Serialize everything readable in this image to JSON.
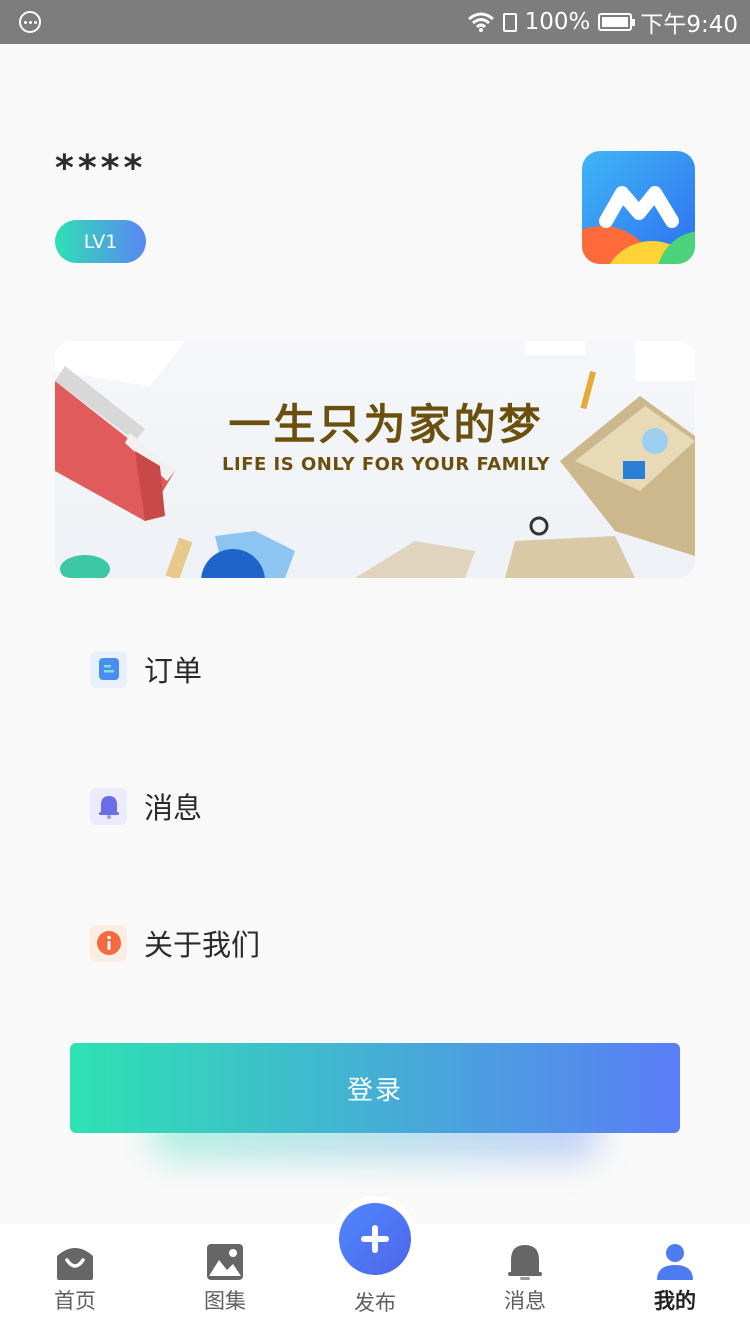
{
  "status_bar": {
    "battery": "100%",
    "time": "下午9:40"
  },
  "profile": {
    "name": "****",
    "level": "LV1"
  },
  "banner": {
    "title": "一生只为家的梦",
    "subtitle": "LIFE IS ONLY FOR YOUR FAMILY"
  },
  "menu": [
    {
      "label": "订单",
      "icon": "order-icon"
    },
    {
      "label": "消息",
      "icon": "bell-icon"
    },
    {
      "label": "关于我们",
      "icon": "info-icon"
    }
  ],
  "login_label": "登录",
  "tabs": [
    {
      "label": "首页",
      "icon": "home-bag-icon"
    },
    {
      "label": "图集",
      "icon": "image-gallery-icon"
    },
    {
      "label": "发布",
      "icon": "plus-icon"
    },
    {
      "label": "消息",
      "icon": "bell-icon"
    },
    {
      "label": "我的",
      "icon": "person-icon",
      "active": true
    }
  ],
  "colors": {
    "accent_start": "#2fe0b4",
    "accent_end": "#5a7df6",
    "banner_text": "#6b4f0c"
  }
}
